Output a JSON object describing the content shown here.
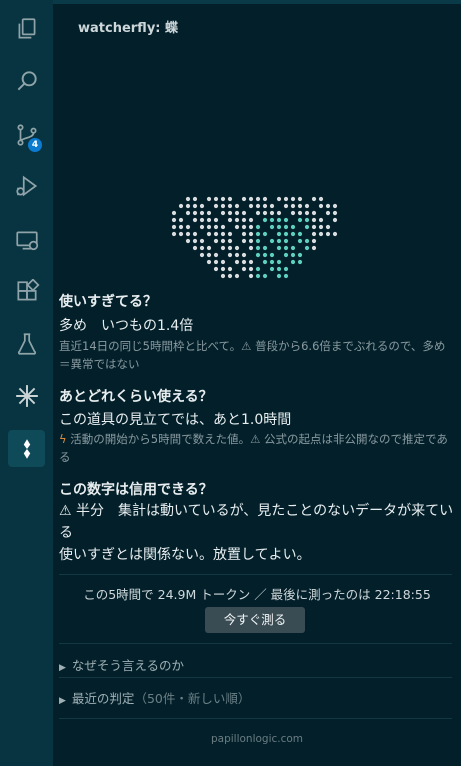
{
  "activity_bar": {
    "scm_badge": "4",
    "items": [
      "explorer",
      "search",
      "source-control",
      "run-debug",
      "remote-explorer",
      "extensions",
      "testing",
      "sparkle",
      "watcherfly"
    ]
  },
  "panel": {
    "title": "watcherfly: 蝶"
  },
  "usage": {
    "heading": "使いすぎてる？",
    "value": "多め　いつもの1.4倍",
    "note": "直近14日の同じ5時間枠と比べて。⚠ 普段から6.6倍までぶれるので、多め＝異常ではない"
  },
  "remaining": {
    "heading": "あとどれくらい使える？",
    "value": "この道具の見立てでは、あと1.0時間",
    "note": "活動の開始から5時間で数えた値。⚠ 公式の起点は非公開なので推定である"
  },
  "trust": {
    "heading": "この数字は信用できる？",
    "value": "⚠ 半分　集計は動いているが、見たことのないデータが来ている",
    "advice": "使いすぎとは関係ない。放置してよい。"
  },
  "status": {
    "line": "この5時間で 24.9M トークン ／ 最後に測ったのは 22:18:55",
    "measure_button": "今すぐ測る"
  },
  "sections": {
    "why": "なぜそう言えるのか",
    "recent": "最近の判定",
    "recent_hint": "（50件・新しい順）"
  },
  "footer": {
    "link": "papillonlogic.com"
  },
  "colors": {
    "background": "#03202a",
    "activity_bar": "#073440",
    "logo_white": "#d9dde0",
    "logo_teal": "#5fd0c0",
    "badge": "#0a7bd0",
    "bolt": "#d9893a"
  }
}
